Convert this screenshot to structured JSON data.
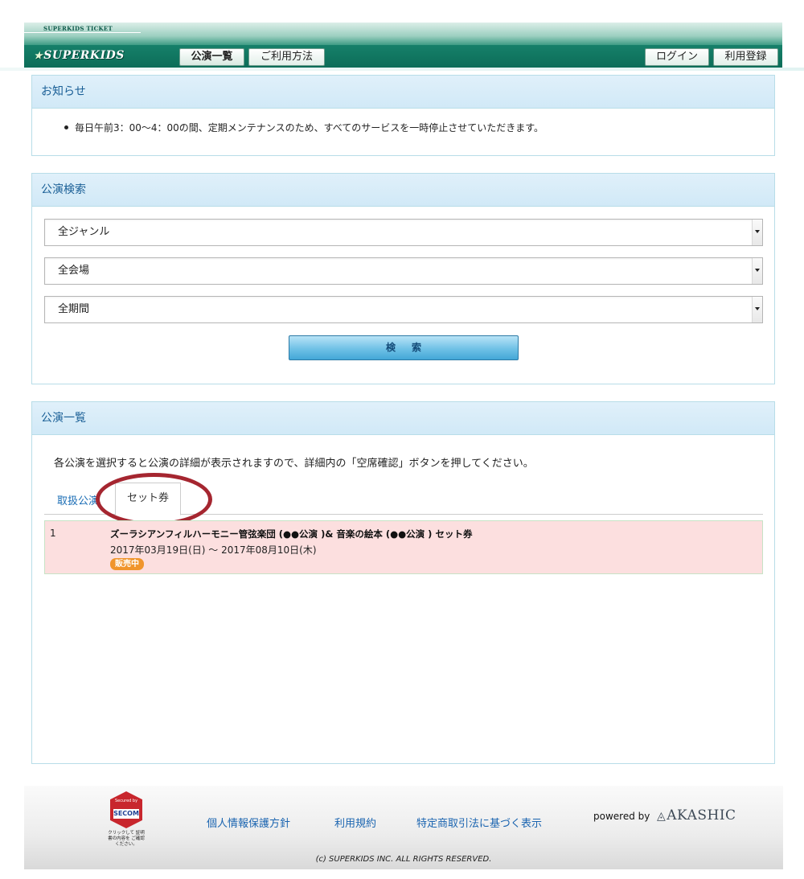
{
  "header": {
    "ticket_label": "SUPERKIDS TICKET",
    "logo_text": "SUPERKIDS",
    "nav": [
      {
        "label": "公演一覧"
      },
      {
        "label": "ご利用方法"
      }
    ],
    "login_label": "ログイン",
    "register_label": "利用登録"
  },
  "notice": {
    "title": "お知らせ",
    "items": [
      "毎日午前3：00～4：00の間、定期メンテナンスのため、すべてのサービスを一時停止させていただきます。"
    ]
  },
  "search": {
    "title": "公演検索",
    "genre_selected": "全ジャンル",
    "venue_selected": "全会場",
    "period_selected": "全期間",
    "button_label": "検索"
  },
  "list": {
    "title": "公演一覧",
    "description": "各公演を選択すると公演の詳細が表示されますので、詳細内の「空席確認」ボタンを押してください。",
    "tabs": [
      {
        "label": "取扱公演"
      },
      {
        "label": "セット券"
      }
    ],
    "rows": [
      {
        "num": "1",
        "title": "ズーラシアンフィルハーモニー管弦楽団 (●●公演 )& 音楽の絵本 (●●公演 ) セット券",
        "date": "2017年03月19日(日) ～ 2017年08月10日(木)",
        "status": "販売中"
      }
    ]
  },
  "footer": {
    "secom_secured": "Secured by",
    "secom_brand": "SECOM",
    "secom_note": "クリックして 証明書の内容を ご確認ください。",
    "links": [
      "個人情報保護方針",
      "利用規約",
      "特定商取引法に基づく表示"
    ],
    "powered_by": "powered by",
    "akashic": "AKASHIC",
    "copyright": "(c) SUPERKIDS INC. ALL RIGHTS RESERVED."
  },
  "colors": {
    "header_green": "#0c6d58",
    "panel_head_bg": "#d1e9f7",
    "panel_title": "#1a5f96",
    "row_bg": "#fcdfdf",
    "badge": "#f0952c",
    "highlight_ring": "#a52630",
    "link": "#1a64b0"
  }
}
